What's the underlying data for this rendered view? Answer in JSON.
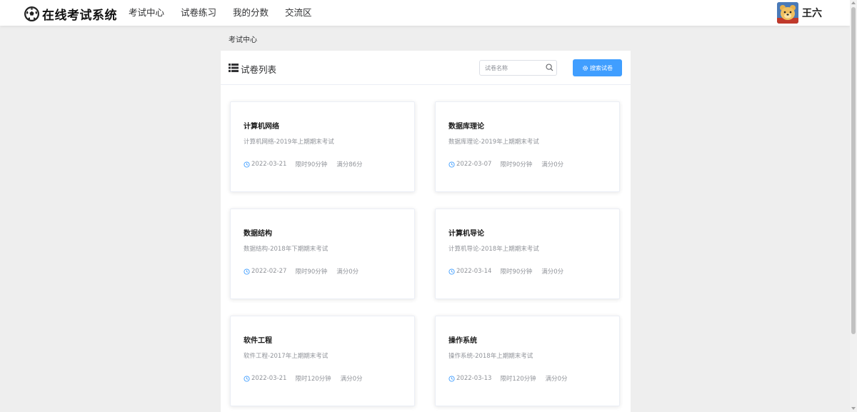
{
  "header": {
    "logo_text": "在线考试系统",
    "logo_icon": "soccer-ball-icon",
    "nav": [
      "考试中心",
      "试卷练习",
      "我的分数",
      "交流区"
    ],
    "user_name": "王六"
  },
  "breadcrumb": "考试中心",
  "panel": {
    "title": "试卷列表",
    "search_placeholder": "试卷名称",
    "search_button": "搜索试卷"
  },
  "exams": [
    {
      "title": "计算机网络",
      "desc": "计算机网络-2019年上期期末考试",
      "date": "2022-03-21",
      "duration": "限时90分钟",
      "score": "满分86分"
    },
    {
      "title": "数据库理论",
      "desc": "数据库理论-2019年上期期末考试",
      "date": "2022-03-07",
      "duration": "限时90分钟",
      "score": "满分0分"
    },
    {
      "title": "数据结构",
      "desc": "数据结构-2018年下期期末考试",
      "date": "2022-02-27",
      "duration": "限时90分钟",
      "score": "满分0分"
    },
    {
      "title": "计算机导论",
      "desc": "计算机导论-2018年上期期末考试",
      "date": "2022-03-14",
      "duration": "限时90分钟",
      "score": "满分0分"
    },
    {
      "title": "软件工程",
      "desc": "软件工程-2017年上期期末考试",
      "date": "2022-03-21",
      "duration": "限时120分钟",
      "score": "满分0分"
    },
    {
      "title": "操作系统",
      "desc": "操作系统-2018年上期期末考试",
      "date": "2022-03-13",
      "duration": "限时120分钟",
      "score": "满分0分"
    }
  ],
  "colors": {
    "accent": "#409eff",
    "background": "#eeeeee",
    "muted_text": "#909399"
  }
}
